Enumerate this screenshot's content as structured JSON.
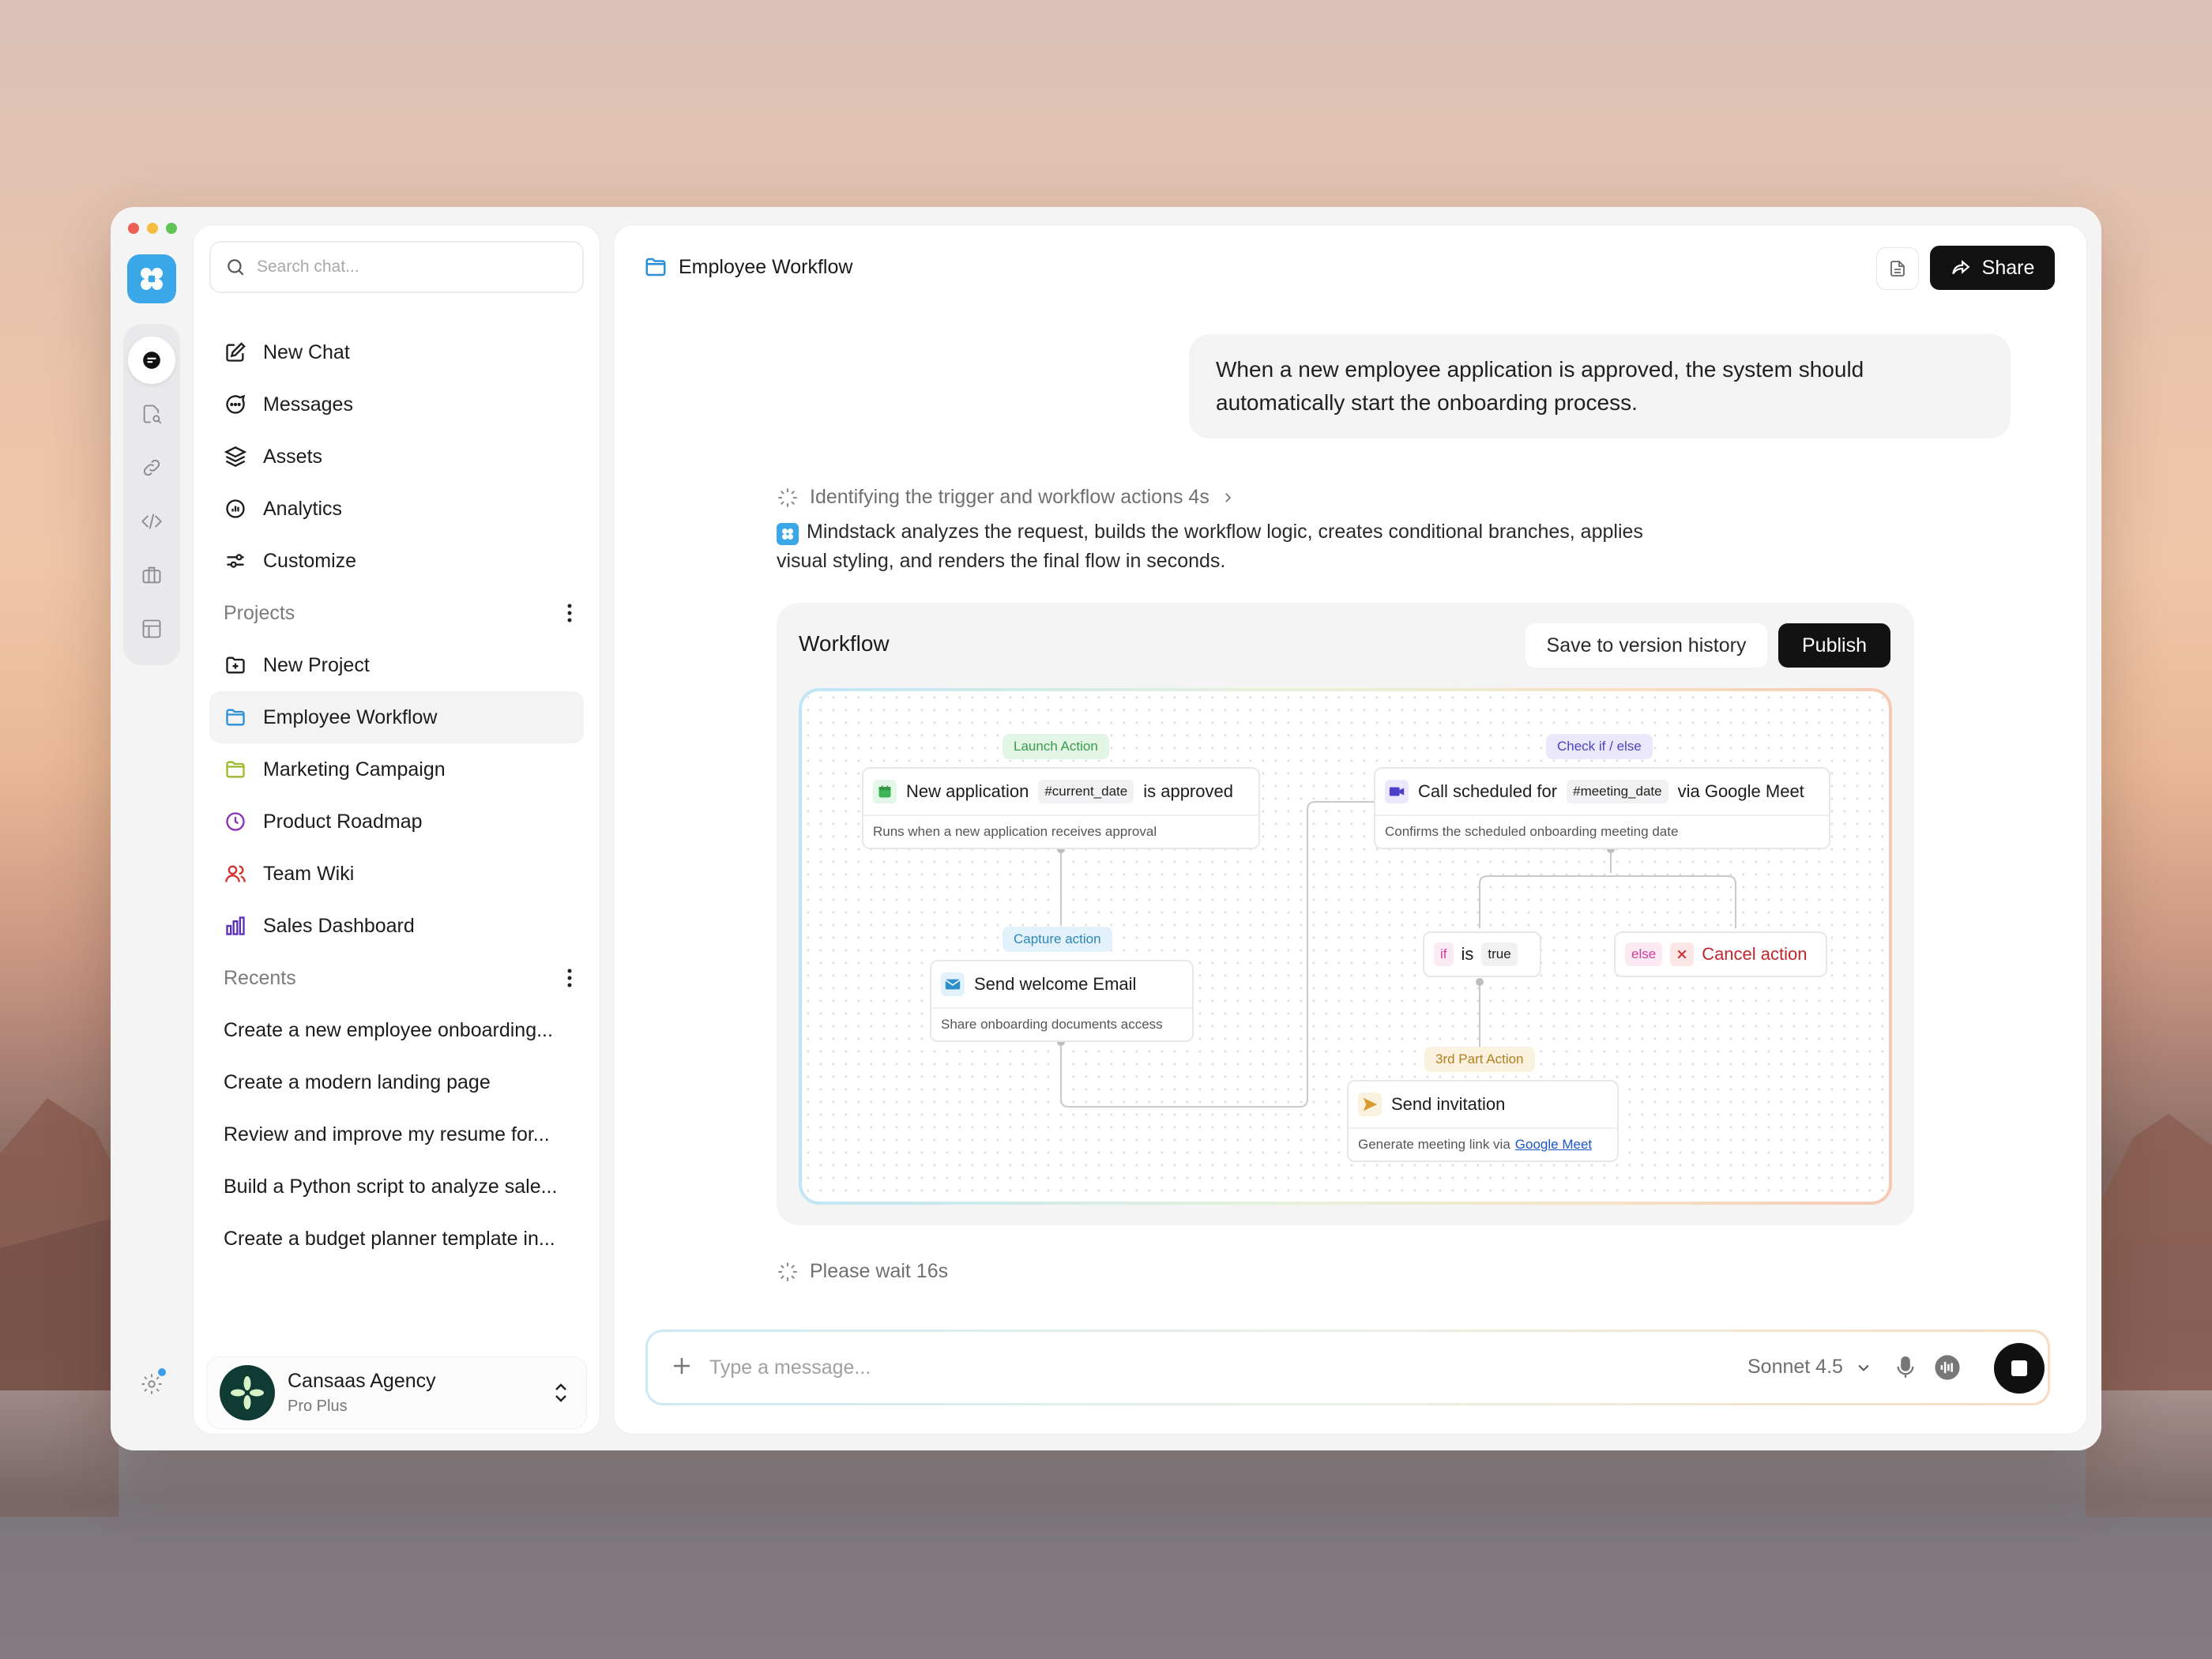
{
  "colors": {
    "accent": "#3aa7e8",
    "dark_button": "#121212",
    "launch_tag": "#e3f6e6",
    "capture_tag": "#e3f2fa",
    "check_tag": "#ebe8fb",
    "third_tag": "#fbf1df",
    "cancel_red": "#c0262d"
  },
  "window_controls": [
    "close",
    "minimize",
    "zoom"
  ],
  "rail": {
    "items": [
      "chat-icon",
      "file-search-icon",
      "link-icon",
      "code-icon",
      "briefcase-icon",
      "layout-icon"
    ],
    "settings": "gear-icon"
  },
  "sidebar": {
    "search_placeholder": "Search chat...",
    "nav": [
      {
        "label": "New Chat",
        "icon": "edit-icon"
      },
      {
        "label": "Messages",
        "icon": "message-icon"
      },
      {
        "label": "Assets",
        "icon": "layers-icon"
      },
      {
        "label": "Analytics",
        "icon": "analytics-icon"
      },
      {
        "label": "Customize",
        "icon": "sliders-icon"
      }
    ],
    "projects_label": "Projects",
    "projects": [
      {
        "label": "New Project",
        "icon": "folder-plus-icon"
      },
      {
        "label": "Employee Workflow",
        "icon": "folder-icon"
      },
      {
        "label": "Marketing Campaign",
        "icon": "folder-icon"
      },
      {
        "label": "Product Roadmap",
        "icon": "clock-icon"
      },
      {
        "label": "Team Wiki",
        "icon": "users-icon"
      },
      {
        "label": "Sales Dashboard",
        "icon": "bar-chart-icon"
      }
    ],
    "recents_label": "Recents",
    "recents": [
      "Create a new employee onboarding...",
      "Create a modern landing page",
      "Review and improve my resume for...",
      "Build a Python script to analyze sale...",
      "Create a budget planner template in..."
    ],
    "profile": {
      "name": "Cansaas Agency",
      "plan": "Pro Plus"
    }
  },
  "main": {
    "title": "Employee Workflow",
    "share_label": "Share",
    "user_message": "When a new employee application is approved, the system should automatically start the onboarding process.",
    "thinking": "Identifying the trigger and workflow actions 4s",
    "answer": "Mindstack analyzes the request, builds the workflow logic, creates conditional branches, applies visual styling, and renders the final flow in seconds.",
    "workflow": {
      "title": "Workflow",
      "save_label": "Save to version history",
      "publish_label": "Publish",
      "nodes": {
        "launch": {
          "tag": "Launch Action",
          "pre": "New application",
          "pill": "#current_date",
          "post": "is approved",
          "sub": "Runs when a new application receives approval"
        },
        "capture": {
          "tag": "Capture action",
          "title": "Send welcome Email",
          "sub": "Share onboarding documents access"
        },
        "check": {
          "tag": "Check if / else",
          "pre": "Call scheduled for",
          "pill": "#meeting_date",
          "post": "via Google Meet",
          "sub": "Confirms the scheduled onboarding meeting date"
        },
        "if_branch": {
          "if": "if",
          "is": "is",
          "value": "true"
        },
        "else_branch": {
          "else": "else",
          "label": "Cancel action"
        },
        "third": {
          "tag": "3rd Part Action",
          "title": "Send invitation",
          "sub_pre": "Generate meeting link via ",
          "sub_link": "Google Meet"
        }
      }
    },
    "wait_status": "Please wait 16s",
    "input_placeholder": "Type a message...",
    "model": "Sonnet 4.5"
  }
}
